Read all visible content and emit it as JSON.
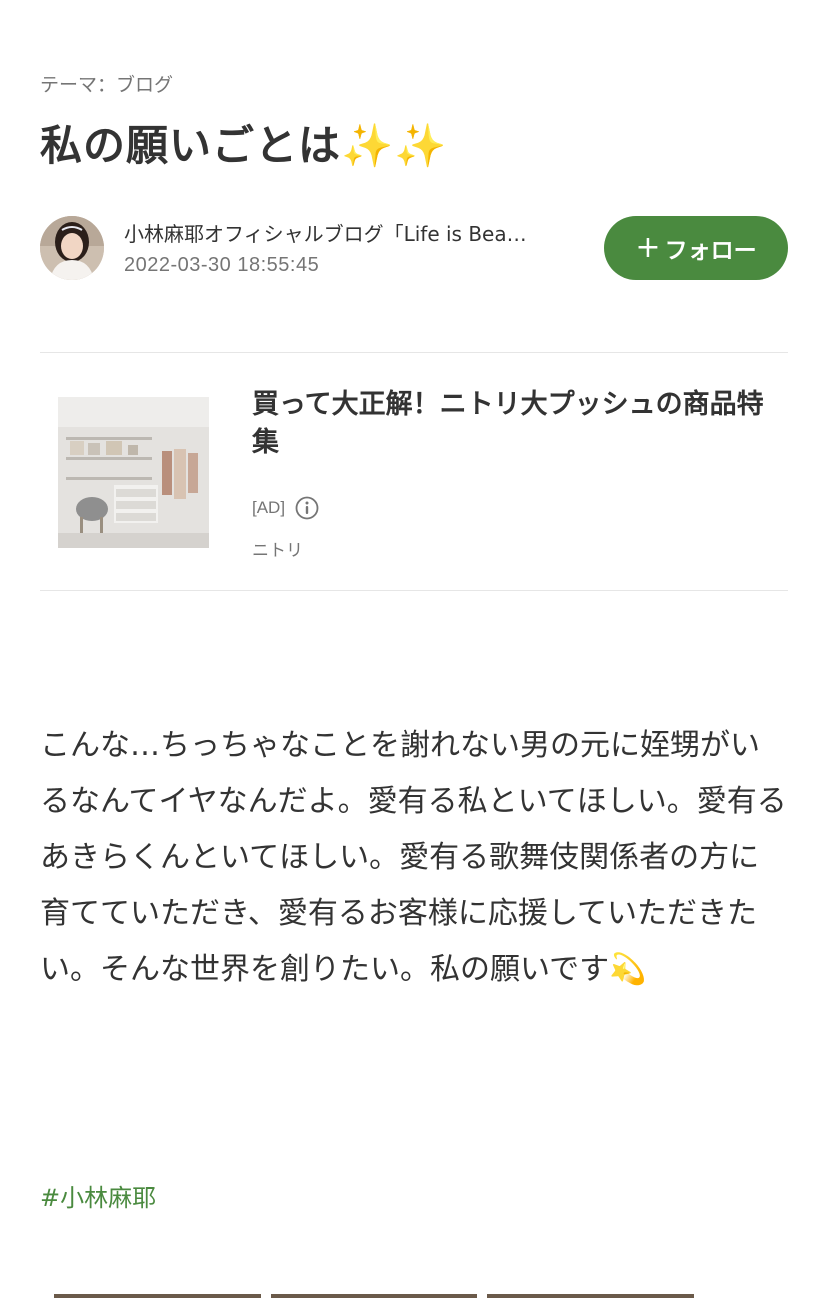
{
  "header": {
    "theme": "テーマ：ブログ",
    "title": "私の願いごとは✨✨"
  },
  "author": {
    "blog_name": "小林麻耶オフィシャルブログ「Life is Bea…",
    "date": "2022-03-30 18:55:45",
    "follow_label": "フォロー",
    "follow_icon": "plus-icon"
  },
  "ad": {
    "title": "買って大正解！ニトリ大プッシュの商品特集",
    "label": "[AD]",
    "info_icon": "info-icon",
    "sponsor": "ニトリ"
  },
  "article": {
    "body": "こんな…ちっちゃなことを謝れない男の元に姪甥がいるなんてイヤなんだよ。愛有る私といてほしい。愛有るあきらくんといてほしい。愛有る歌舞伎関係者の方に育てていただき、愛有るお客様に応援していただきたい。そんな世界を創りたい。私の願いです",
    "emoji": "💫",
    "hashtag": "#小林麻耶"
  },
  "colors": {
    "accent": "#4a8a3f",
    "text": "#333333",
    "muted": "#757575",
    "divider": "#e6e6e6"
  }
}
